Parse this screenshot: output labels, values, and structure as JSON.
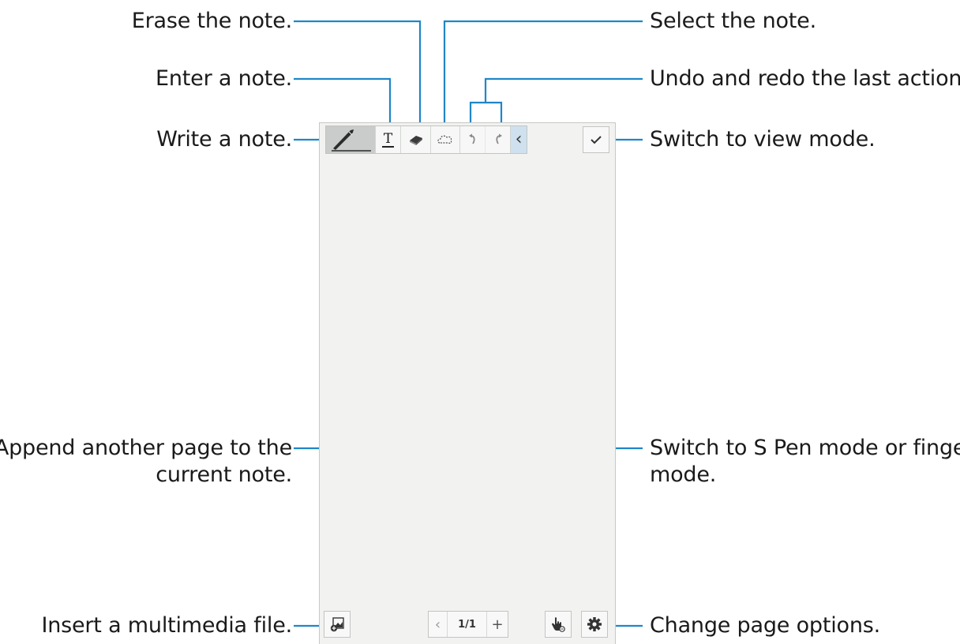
{
  "annotations": {
    "erase": "Erase the note.",
    "enter": "Enter a note.",
    "write": "Write a note.",
    "select": "Select the note.",
    "undo_redo": "Undo and redo the last action.",
    "view_mode": "Switch to view mode.",
    "append_line1": "Append another page to the",
    "append_line2": "current note.",
    "pen_mode_line1": "Switch to S Pen mode or finger",
    "pen_mode_line2": "mode.",
    "insert": "Insert a multimedia file.",
    "page_options": "Change page options."
  },
  "toolbar": {
    "tools": [
      {
        "name": "pen-tool",
        "icon": "pen-icon",
        "active": true
      },
      {
        "name": "text-tool",
        "icon": "text-icon"
      },
      {
        "name": "eraser-tool",
        "icon": "eraser-icon"
      },
      {
        "name": "select-tool",
        "icon": "lasso-icon"
      },
      {
        "name": "undo",
        "icon": "undo-icon"
      },
      {
        "name": "redo",
        "icon": "redo-icon"
      },
      {
        "name": "collapse",
        "icon": "chevron-left-icon"
      }
    ],
    "text_tool_glyph": "T",
    "collapse_glyph": "‹"
  },
  "pager": {
    "prev_glyph": "‹",
    "page": "1/1",
    "add_glyph": "+"
  },
  "colors": {
    "callout_line": "#1f86c8",
    "canvas_bg": "#f2f3f1",
    "active_tool_bg": "#c9ccca",
    "collapse_bg": "#cfe1ee"
  }
}
